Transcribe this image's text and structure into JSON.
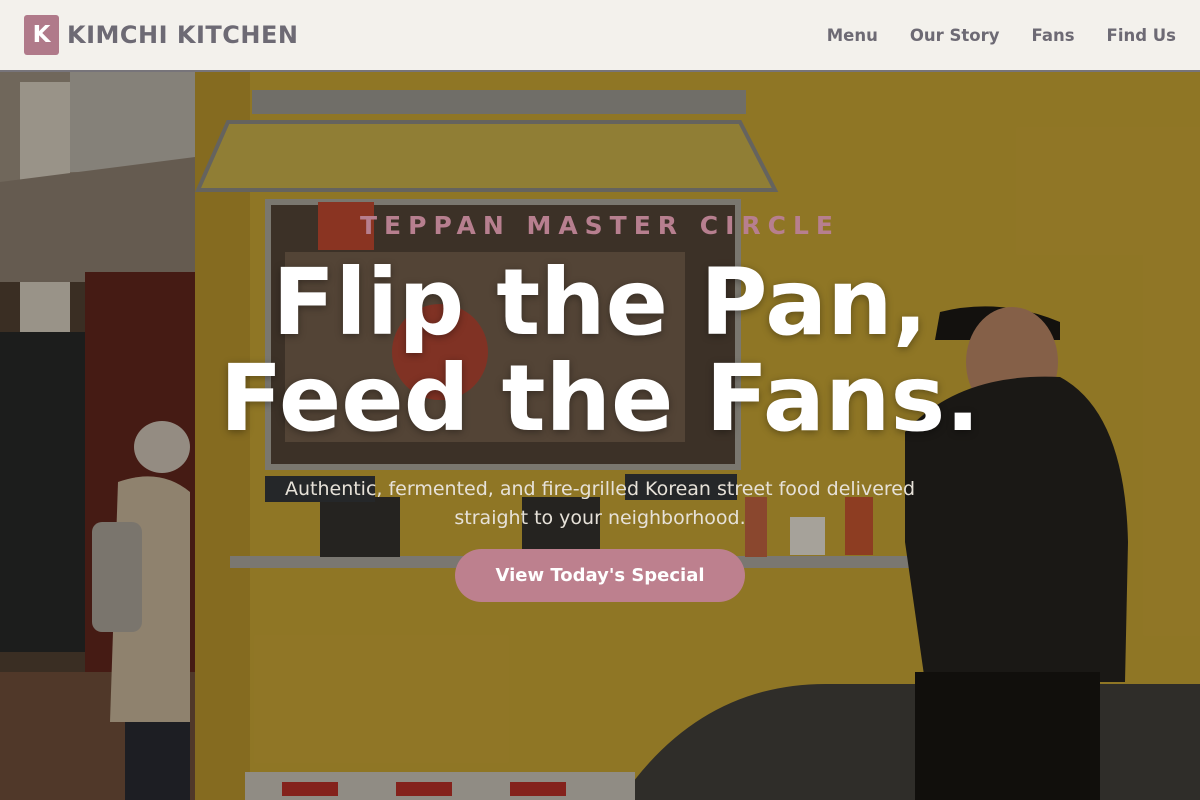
{
  "brand": {
    "logo_letter": "K",
    "name": "KIMCHI KITCHEN"
  },
  "nav": {
    "links": [
      {
        "label": "Menu"
      },
      {
        "label": "Our Story"
      },
      {
        "label": "Fans"
      },
      {
        "label": "Find Us"
      }
    ]
  },
  "hero": {
    "eyebrow": "TEPPAN MASTER CIRCLE",
    "headline_line1": "Flip the Pan,",
    "headline_line2": "Feed the Fans.",
    "subtext": "Authentic, fermented, and fire-grilled Korean street food delivered straight to your neighborhood.",
    "cta_label": "View Today's Special",
    "background_image": "food-truck-photo"
  },
  "colors": {
    "accent": "#bd808e",
    "nav_background": "#f3f1ec",
    "nav_text": "#6d6a74",
    "truck_yellow": "#c8a533"
  }
}
